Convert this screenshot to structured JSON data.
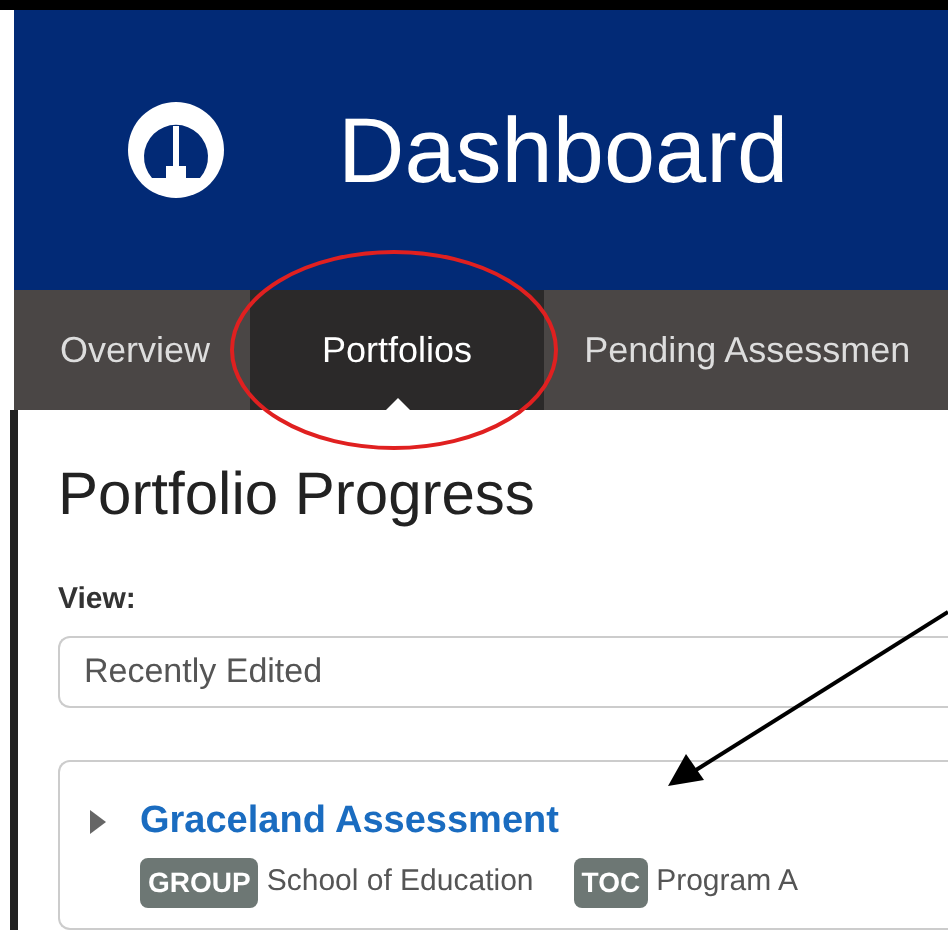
{
  "header": {
    "title": "Dashboard"
  },
  "tabs": [
    {
      "label": "Overview",
      "selected": false
    },
    {
      "label": "Portfolios",
      "selected": true
    },
    {
      "label": "Pending Assessmen",
      "selected": false
    }
  ],
  "panel": {
    "title": "Portfolio Progress"
  },
  "view": {
    "label": "View:",
    "value": "Recently Edited"
  },
  "portfolios": [
    {
      "title": "Graceland Assessment",
      "expanded": false,
      "tags": [
        {
          "badge": "GROUP",
          "text": "School of Education"
        },
        {
          "badge": "TOC",
          "text": "Program A"
        }
      ]
    }
  ]
}
